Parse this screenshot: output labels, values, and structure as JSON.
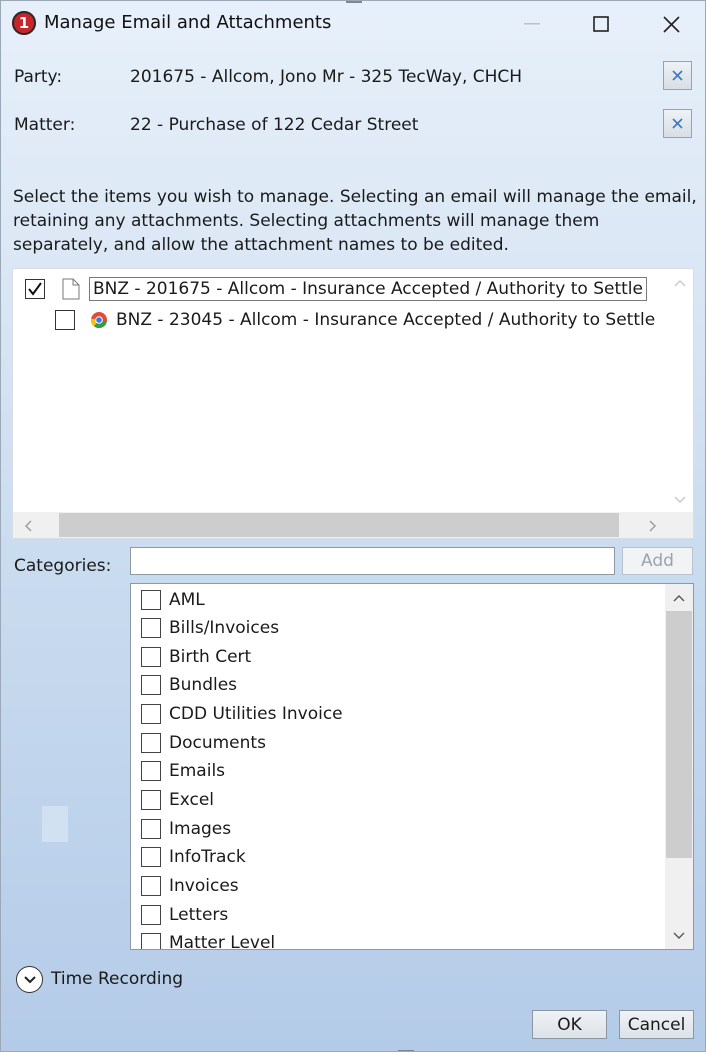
{
  "window": {
    "title": "Manage Email and Attachments"
  },
  "party": {
    "label": "Party:",
    "value": "201675 - Allcom, Jono Mr - 325 TecWay, CHCH"
  },
  "matter": {
    "label": "Matter:",
    "value": "22 - Purchase of 122 Cedar Street"
  },
  "instructions": "Select the items you wish to manage. Selecting an email will manage the email, retaining any attachments. Selecting attachments will manage them separately, and allow the attachment names to be edited.",
  "items": [
    {
      "name": "BNZ - 201675 - Allcom - Insurance Accepted / Authority to Settle",
      "checked": true,
      "icon": "document-icon",
      "editing": true
    },
    {
      "name": "BNZ - 23045 - Allcom - Insurance Accepted / Authority to Settle",
      "checked": false,
      "icon": "chrome-icon",
      "editing": false
    }
  ],
  "categories": {
    "label": "Categories:",
    "input_value": "",
    "add_label": "Add",
    "items": [
      {
        "label": "AML",
        "checked": false
      },
      {
        "label": "Bills/Invoices",
        "checked": false
      },
      {
        "label": "Birth Cert",
        "checked": false
      },
      {
        "label": "Bundles",
        "checked": false
      },
      {
        "label": "CDD Utilities Invoice",
        "checked": false
      },
      {
        "label": "Documents",
        "checked": false
      },
      {
        "label": "Emails",
        "checked": false
      },
      {
        "label": "Excel",
        "checked": false
      },
      {
        "label": "Images",
        "checked": false
      },
      {
        "label": "InfoTrack",
        "checked": false
      },
      {
        "label": "Invoices",
        "checked": false
      },
      {
        "label": "Letters",
        "checked": false
      },
      {
        "label": "Matter Level",
        "checked": false
      }
    ]
  },
  "time_recording": {
    "label": "Time Recording"
  },
  "buttons": {
    "ok": "OK",
    "cancel": "Cancel"
  },
  "colors": {
    "accent": "#c8242b",
    "clear_x": "#3a78c2"
  }
}
